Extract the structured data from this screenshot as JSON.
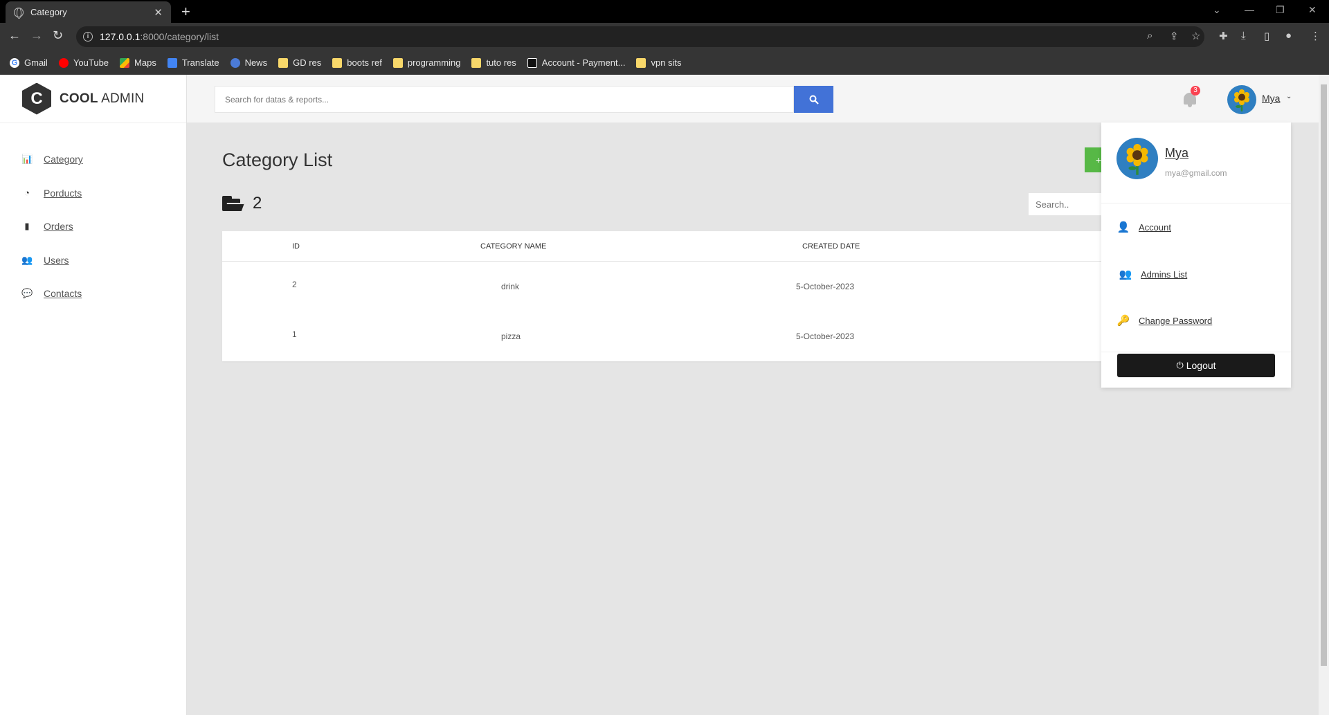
{
  "browser": {
    "tab_title": "Category",
    "url_host": "127.0.0.1",
    "url_path": ":8000/category/list",
    "bookmarks": [
      "Gmail",
      "YouTube",
      "Maps",
      "Translate",
      "News",
      "GD res",
      "boots ref",
      "programming",
      "tuto res",
      "Account - Payment...",
      "vpn sits"
    ]
  },
  "brand": {
    "bold": "COOL",
    "light": "ADMIN",
    "letter": "C"
  },
  "sidebar": {
    "items": [
      {
        "label": "Category",
        "icon": "bar-chart-icon"
      },
      {
        "label": "Porducts",
        "icon": "rss-icon"
      },
      {
        "label": "Orders",
        "icon": "clipboard-icon"
      },
      {
        "label": "Users",
        "icon": "users-icon"
      },
      {
        "label": "Contacts",
        "icon": "chat-icon"
      }
    ]
  },
  "header": {
    "search_placeholder": "Search for datas & reports...",
    "notification_count": "3",
    "user_name": "Mya"
  },
  "main": {
    "title": "Category List",
    "add_label": "+",
    "count": "2",
    "table_search_placeholder": "Search..",
    "columns": [
      "ID",
      "CATEGORY NAME",
      "CREATED DATE"
    ],
    "rows": [
      {
        "id": "2",
        "name": "drink",
        "date": "5-October-2023"
      },
      {
        "id": "1",
        "name": "pizza",
        "date": "5-October-2023"
      }
    ]
  },
  "dropdown": {
    "name": "Mya",
    "email": "mya@gmail.com",
    "items": [
      {
        "label": "Account",
        "icon": "user-icon"
      },
      {
        "label": "Admins List",
        "icon": "users-icon"
      },
      {
        "label": "Change Password",
        "icon": "key-icon"
      }
    ],
    "logout_label": "Logout"
  },
  "colors": {
    "search_button": "#4272d7",
    "add_button": "#57b846",
    "badge": "#fa4251",
    "logout": "#1a1a1a"
  }
}
